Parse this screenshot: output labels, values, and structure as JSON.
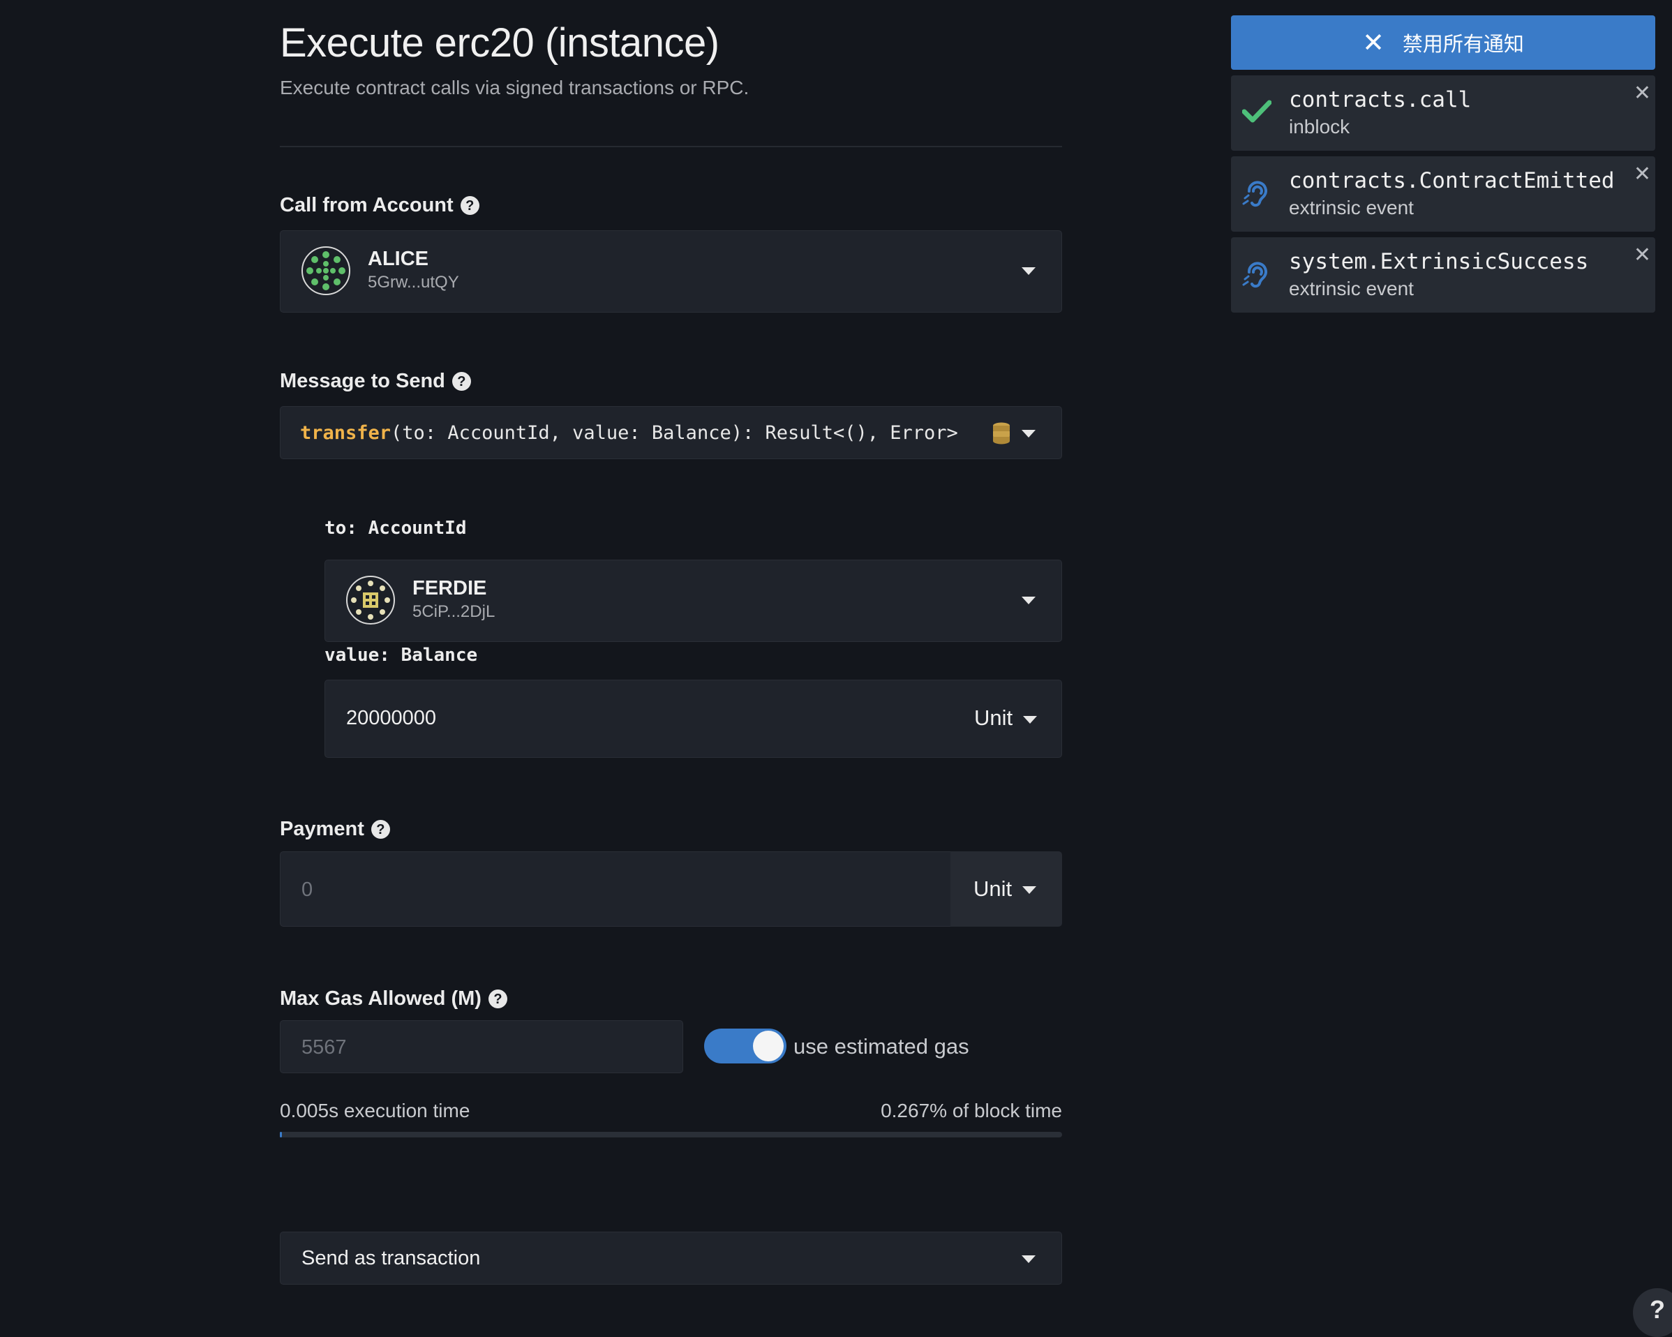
{
  "header": {
    "title": "Execute erc20 (instance)",
    "subtitle": "Execute contract calls via signed transactions or RPC."
  },
  "call_from": {
    "label": "Call from Account",
    "account_name": "ALICE",
    "account_address": "5Grw...utQY"
  },
  "message": {
    "label": "Message to Send",
    "method": "transfer",
    "signature": "(to: AccountId, value: Balance): Result<(), Error>"
  },
  "params": {
    "to_label": "to: AccountId",
    "to_account_name": "FERDIE",
    "to_account_address": "5CiP...2DjL",
    "value_label": "value: Balance",
    "value": "20000000",
    "value_unit": "Unit"
  },
  "payment": {
    "label": "Payment",
    "placeholder": "0",
    "unit": "Unit"
  },
  "gas": {
    "label": "Max Gas Allowed (M)",
    "placeholder": "5567",
    "toggle_label": "use estimated gas",
    "toggle_on": true,
    "execution_time": "0.005s execution time",
    "block_time": "0.267% of block time",
    "block_time_percent": 0.267
  },
  "send_mode": {
    "selected": "Send as transaction"
  },
  "notifications": {
    "disable_all": "禁用所有通知",
    "items": [
      {
        "title": "contracts.call",
        "subtitle": "inblock",
        "icon": "check-icon"
      },
      {
        "title": "contracts.ContractEmitted",
        "subtitle": "extrinsic event",
        "icon": "listen-icon"
      },
      {
        "title": "system.ExtrinsicSuccess",
        "subtitle": "extrinsic event",
        "icon": "listen-icon"
      }
    ]
  },
  "help_button": "?",
  "colors": {
    "background": "#13161c",
    "accent": "#3a7bc8",
    "method_highlight": "#f0b34a",
    "success": "#4ec07a",
    "field": "#1f232b"
  }
}
